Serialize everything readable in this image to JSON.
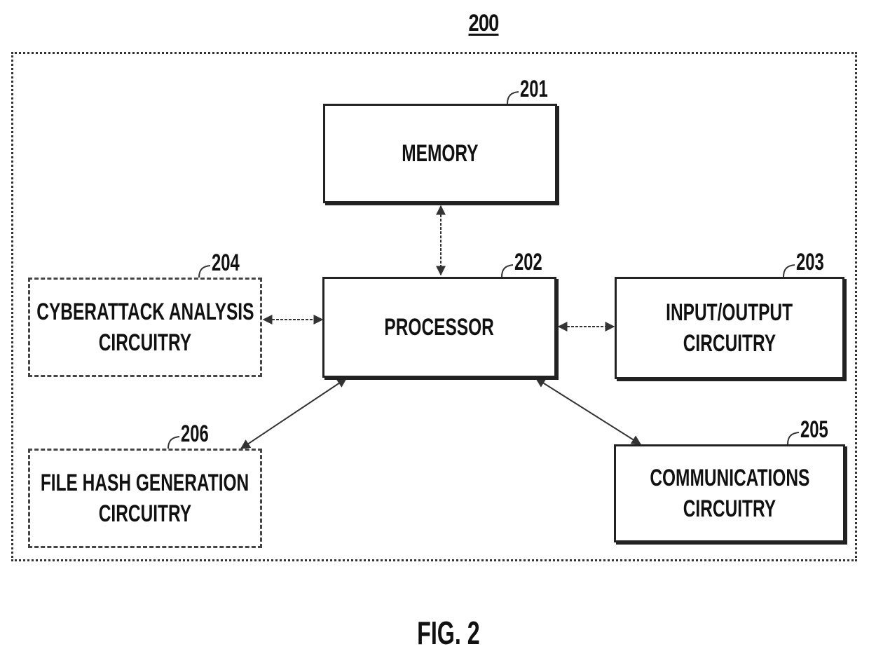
{
  "figure": {
    "number": "200",
    "caption": "FIG. 2"
  },
  "blocks": {
    "memory": {
      "ref": "201",
      "lines": [
        "MEMORY"
      ],
      "style": "solid"
    },
    "processor": {
      "ref": "202",
      "lines": [
        "PROCESSOR"
      ],
      "style": "solid"
    },
    "io": {
      "ref": "203",
      "lines": [
        "INPUT/OUTPUT",
        "CIRCUITRY"
      ],
      "style": "solid"
    },
    "cyberattack": {
      "ref": "204",
      "lines": [
        "CYBERATTACK ANALYSIS",
        "CIRCUITRY"
      ],
      "style": "dashed"
    },
    "communications": {
      "ref": "205",
      "lines": [
        "COMMUNICATIONS",
        "CIRCUITRY"
      ],
      "style": "solid"
    },
    "file_hash": {
      "ref": "206",
      "lines": [
        "FILE HASH GENERATION",
        "CIRCUITRY"
      ],
      "style": "dashed"
    }
  },
  "connections": [
    {
      "from": "memory",
      "to": "processor",
      "bidirectional": true
    },
    {
      "from": "cyberattack",
      "to": "processor",
      "bidirectional": true
    },
    {
      "from": "processor",
      "to": "io",
      "bidirectional": true
    },
    {
      "from": "processor",
      "to": "file_hash",
      "bidirectional": true
    },
    {
      "from": "processor",
      "to": "communications",
      "bidirectional": true
    }
  ]
}
